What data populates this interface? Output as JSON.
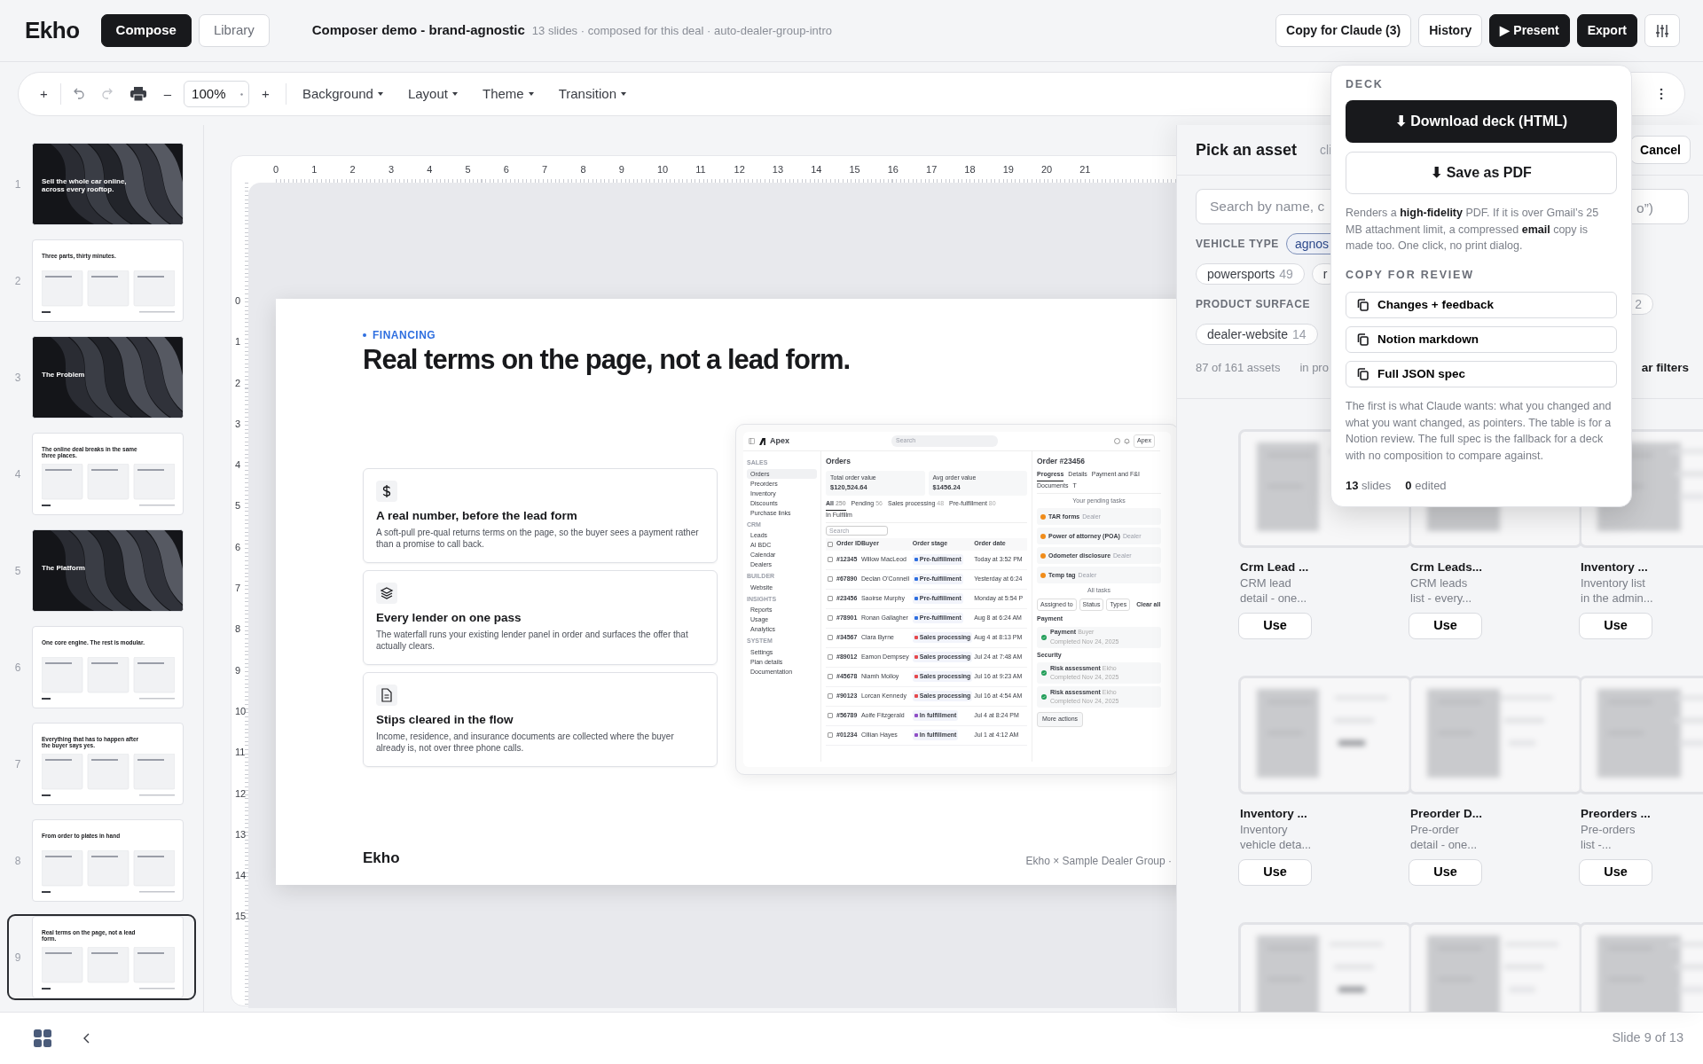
{
  "app": {
    "logo": "Ekho",
    "tabs": [
      {
        "label": "Compose",
        "selected": true
      },
      {
        "label": "Library",
        "selected": false
      }
    ],
    "doc_title": "Composer demo - brand-agnostic",
    "doc_meta": "13 slides · composed for this deal · auto-dealer-group-intro",
    "actions": [
      {
        "label": "Copy for Claude (3)",
        "kind": "outline"
      },
      {
        "label": "History",
        "kind": "outline"
      },
      {
        "label": "▶ Present",
        "kind": "dark"
      },
      {
        "label": "Export",
        "kind": "dark"
      }
    ]
  },
  "toolbar": {
    "add": "+",
    "zoom_out": "–",
    "zoom": "100%",
    "zoom_in": "+",
    "menus": [
      "Background",
      "Layout",
      "Theme",
      "Transition"
    ]
  },
  "thumbnails": [
    {
      "number": "1",
      "title": "Sell the whole car online, across every rooftop.",
      "kind": "dark",
      "selected": false
    },
    {
      "number": "2",
      "title": "Three parts, thirty minutes.",
      "kind": "light",
      "selected": false
    },
    {
      "number": "3",
      "title": "The Problem",
      "kind": "dark",
      "selected": false
    },
    {
      "number": "4",
      "title": "The online deal breaks in the same three places.",
      "kind": "light",
      "selected": false
    },
    {
      "number": "5",
      "title": "The Platform",
      "kind": "dark",
      "selected": false
    },
    {
      "number": "6",
      "title": "One core engine. The rest is modular.",
      "kind": "light",
      "selected": false
    },
    {
      "number": "7",
      "title": "Everything that has to happen after the buyer says yes.",
      "kind": "light",
      "selected": false
    },
    {
      "number": "8",
      "title": "From order to plates in hand",
      "kind": "light",
      "selected": false
    },
    {
      "number": "9",
      "title": "Real terms on the page, not a lead form.",
      "kind": "light",
      "selected": true
    }
  ],
  "rulers": {
    "horizontal": [
      "0",
      "1",
      "2",
      "3",
      "4",
      "5",
      "6",
      "7",
      "8",
      "9",
      "10",
      "11",
      "12",
      "13",
      "14",
      "15",
      "16",
      "17",
      "18",
      "19",
      "20",
      "21"
    ],
    "vertical": [
      "0",
      "1",
      "2",
      "3",
      "4",
      "5",
      "6",
      "7",
      "8",
      "9",
      "10",
      "11",
      "12",
      "13",
      "14",
      "15"
    ]
  },
  "slide": {
    "eyebrow": "FINANCING",
    "title": "Real terms on the page, not a lead form.",
    "cards": [
      {
        "kind": "dollar",
        "title": "A real number, before the lead form",
        "text": "A soft-pull pre-qual returns terms on the page, so the buyer sees a payment rather than a promise to call back."
      },
      {
        "kind": "layers",
        "title": "Every lender on one pass",
        "text": "The waterfall runs your existing lender panel in order and surfaces the offer that actually clears."
      },
      {
        "kind": "document",
        "title": "Stips cleared in the flow",
        "text": "Income, residence, and insurance documents are collected where the buyer already is, not over three phone calls."
      }
    ],
    "footer_logo": "Ekho",
    "footer_text": "Ekho × Sample Dealer Group ·",
    "screenshot": {
      "brand": "Apex",
      "search": "Search",
      "account": "Apex",
      "nav": [
        {
          "section": "SALES",
          "items": [
            {
              "label": "Orders",
              "selected": true
            },
            {
              "label": "Preorders",
              "selected": false
            },
            {
              "label": "Inventory",
              "selected": false
            },
            {
              "label": "Discounts",
              "selected": false
            },
            {
              "label": "Purchase links",
              "selected": false
            }
          ]
        },
        {
          "section": "CRM",
          "items": [
            {
              "label": "Leads",
              "selected": false
            },
            {
              "label": "AI BDC",
              "selected": false
            },
            {
              "label": "Calendar",
              "selected": false
            },
            {
              "label": "Dealers",
              "selected": false
            }
          ]
        },
        {
          "section": "BUILDER",
          "items": [
            {
              "label": "Website",
              "selected": false
            }
          ]
        },
        {
          "section": "INSIGHTS",
          "items": [
            {
              "label": "Reports",
              "selected": false
            },
            {
              "label": "Usage",
              "selected": false
            },
            {
              "label": "Analytics",
              "selected": false
            }
          ]
        },
        {
          "section": "SYSTEM",
          "items": [
            {
              "label": "Settings",
              "selected": false
            },
            {
              "label": "Plan details",
              "selected": false
            },
            {
              "label": "Documentation",
              "selected": false
            }
          ]
        }
      ],
      "orders_title": "Orders",
      "stats": [
        {
          "label": "Total order value",
          "value": "$120,524.64"
        },
        {
          "label": "Avg order value",
          "value": "$1456.24"
        }
      ],
      "tabs": [
        {
          "label": "All",
          "count": "250",
          "selected": true
        },
        {
          "label": "Pending",
          "count": "56",
          "selected": false
        },
        {
          "label": "Sales processing",
          "count": "48",
          "selected": false
        },
        {
          "label": "Pre-fulfillment",
          "count": "80",
          "selected": false
        },
        {
          "label": "In Fulfillm",
          "selected": false
        }
      ],
      "table_search": "Search",
      "columns": [
        "Order ID",
        "Buyer",
        "Order stage",
        "Order date"
      ],
      "all_checked": false,
      "rows": [
        {
          "checked": false,
          "id": "#12345",
          "buyer": "Willow MacLeod",
          "stage": "Pre-fulfillment",
          "color": "#2f6fe0",
          "date": "Today at 3:52 PM"
        },
        {
          "checked": false,
          "id": "#67890",
          "buyer": "Declan O'Connell",
          "stage": "Pre-fulfillment",
          "color": "#2f6fe0",
          "date": "Yesterday at 6:24"
        },
        {
          "checked": false,
          "id": "#23456",
          "buyer": "Saoirse Murphy",
          "stage": "Pre-fulfillment",
          "color": "#2f6fe0",
          "date": "Monday at 5:54 P"
        },
        {
          "checked": false,
          "id": "#78901",
          "buyer": "Ronan Gallagher",
          "stage": "Pre-fulfillment",
          "color": "#2f6fe0",
          "date": "Aug 8 at 6:24 AM"
        },
        {
          "checked": false,
          "id": "#34567",
          "buyer": "Clara Byrne",
          "stage": "Sales processing",
          "color": "#e5484d",
          "date": "Aug 4 at 8:13 PM"
        },
        {
          "checked": false,
          "id": "#89012",
          "buyer": "Eamon Dempsey",
          "stage": "Sales processing",
          "color": "#e5484d",
          "date": "Jul 24 at 7:48 AM"
        },
        {
          "checked": false,
          "id": "#45678",
          "buyer": "Niamh Molloy",
          "stage": "Sales processing",
          "color": "#e5484d",
          "date": "Jul 16 at 9:23 AM"
        },
        {
          "checked": false,
          "id": "#90123",
          "buyer": "Lorcan Kennedy",
          "stage": "Sales processing",
          "color": "#e5484d",
          "date": "Jul 16 at 4:54 AM"
        },
        {
          "checked": false,
          "id": "#56789",
          "buyer": "Aoife Fitzgerald",
          "stage": "In fulfillment",
          "color": "#8e4ec6",
          "date": "Jul 4 at 8:24 PM"
        },
        {
          "checked": false,
          "id": "#01234",
          "buyer": "Cillian Hayes",
          "stage": "In fulfillment",
          "color": "#8e4ec6",
          "date": "Jul 1 at 4:12 AM"
        }
      ],
      "order_title": "Order #23456",
      "order_tabs": [
        {
          "label": "Progress",
          "selected": true
        },
        {
          "label": "Details",
          "selected": false
        },
        {
          "label": "Payment and F&I",
          "selected": false
        },
        {
          "label": "Documents",
          "selected": false
        },
        {
          "label": "T",
          "selected": false
        }
      ],
      "pending_label": "Your pending tasks",
      "tasks": [
        {
          "name": "TAR forms",
          "owner": "Dealer"
        },
        {
          "name": "Power of attorney (POA)",
          "owner": "Dealer"
        },
        {
          "name": "Odometer disclosure",
          "owner": "Dealer"
        },
        {
          "name": "Temp tag",
          "owner": "Dealer"
        }
      ],
      "all_tasks": "All tasks",
      "filters": [
        "Assigned to",
        "Status",
        "Types"
      ],
      "clear": "Clear all",
      "groups": [
        {
          "title": "Payment",
          "items": [
            {
              "name": "Payment",
              "owner": "Buyer",
              "note": "Completed Nov 24, 2025"
            }
          ]
        },
        {
          "title": "Security",
          "items": [
            {
              "name": "Risk assessment",
              "owner": "Ekho",
              "note": "Completed Nov 24, 2025"
            },
            {
              "name": "Risk assessment",
              "owner": "Ekho",
              "note": "Completed Nov 24, 2025"
            }
          ]
        }
      ],
      "more": "More actions"
    }
  },
  "asset_picker": {
    "title": "Pick an asset",
    "hint": "cli",
    "cancel": "Cancel",
    "placeholder": "Search by name, c",
    "placeholder_tail": "o”)",
    "filter_rows": [
      {
        "label": "VEHICLE TYPE",
        "chips": [
          {
            "label": "agnos",
            "selected": true
          }
        ]
      },
      {
        "chips": [
          {
            "label": "powersports",
            "count": "49",
            "selected": false
          },
          {
            "label": "r",
            "selected": false
          }
        ]
      },
      {
        "label": "PRODUCT SURFACE",
        "chips": [
          {
            "count": "2",
            "selected": false
          }
        ]
      },
      {
        "chips": [
          {
            "label": "dealer-website",
            "count": "14",
            "selected": false
          }
        ]
      }
    ],
    "summary": "87 of 161 assets",
    "scope": "in pro",
    "clear": "ar filters",
    "assets": [
      {
        "kind": "full",
        "title": "Crm Lead ...",
        "text": "CRM lead\ndetail - one...",
        "button": "Use"
      },
      {
        "kind": "full",
        "title": "Crm Leads...",
        "text": "CRM leads\nlist - every...",
        "button": "Use"
      },
      {
        "kind": "full",
        "title": "Inventory ...",
        "text": "Inventory list\nin the admin...",
        "button": "Use"
      },
      {
        "kind": "full",
        "title": "Inventory ...",
        "text": "Inventory\nvehicle deta...",
        "button": "Use"
      },
      {
        "kind": "full",
        "title": "Preorder D...",
        "text": "Pre-order\ndetail - one...",
        "button": "Use"
      },
      {
        "kind": "full",
        "title": "Preorders ...",
        "text": "Pre-orders\nlist -...",
        "button": "Use"
      },
      {
        "kind": "cut"
      },
      {
        "kind": "cut"
      },
      {
        "kind": "cut"
      }
    ]
  },
  "export_menu": {
    "deck_label": "DECK",
    "download": "⬇ Download deck (HTML)",
    "pdf": "⬇ Save as PDF",
    "pdf_note": "Renders a **high-fidelity** PDF. If it is over Gmail’s 25 MB attachment limit, a compressed **email** copy is made too. One click, no print dialog.",
    "review_label": "COPY FOR REVIEW",
    "copies": [
      "Changes + feedback",
      "Notion markdown",
      "Full JSON spec"
    ],
    "review_note": "The first is what Claude wants: what you changed and what you want changed, as pointers. The table is for a Notion review. The full spec is the fallback for a deck with no composition to compare against.",
    "stats": [
      "**13** slides",
      "**0** edited"
    ]
  },
  "status_bar": {
    "position": "Slide 9 of 13"
  }
}
